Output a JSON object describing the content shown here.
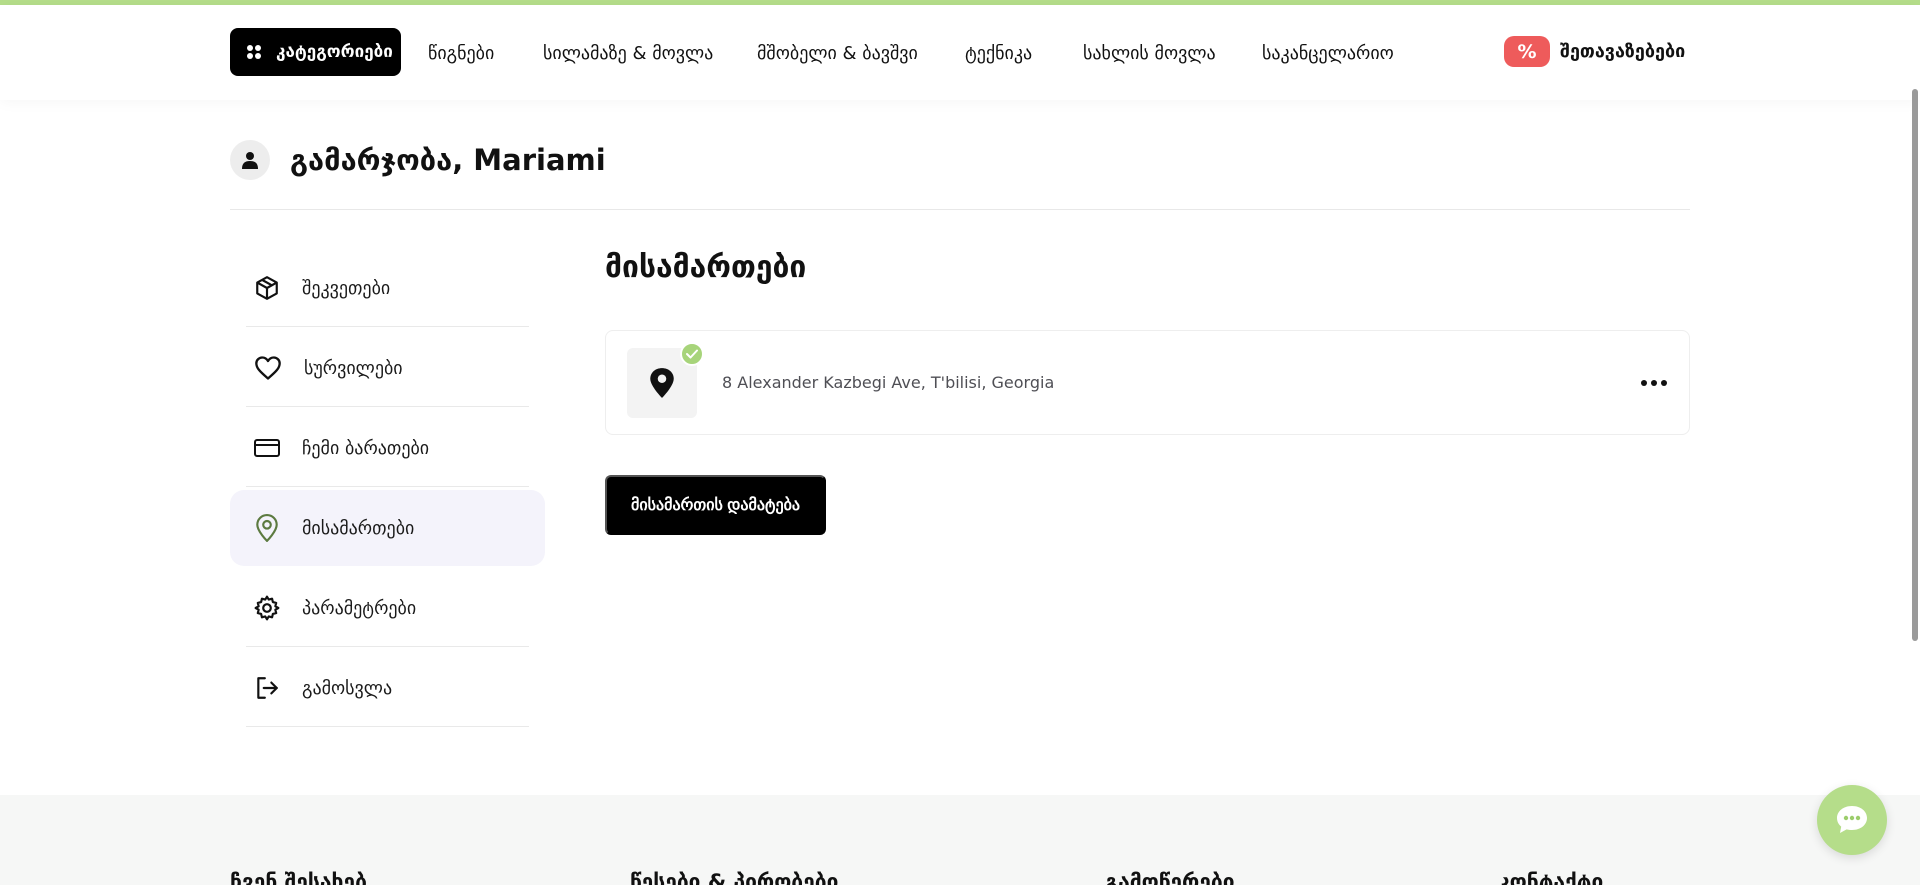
{
  "theme": {
    "accent_green": "#b5dd8a",
    "promo_red": "#ee5b5b",
    "active_bg": "#f4f3fb",
    "check_green": "#a7d47a"
  },
  "topnav": {
    "categories_label": "კატეგორიები",
    "categories_icon": "grid-dots-icon",
    "items": [
      "წიგნები",
      "სილამაზე & მოვლა",
      "მშობელი & ბავშვი",
      "ტექნიკა",
      "სახლის მოვლა",
      "საკანცელარიო"
    ],
    "promo_badge": "%",
    "promo_label": "შეთავაზებები"
  },
  "greeting": {
    "text": "გამარჯობა, Mariami",
    "icon": "user-icon"
  },
  "sidebar": {
    "items": [
      {
        "label": "შეკვეთები",
        "icon": "box-icon"
      },
      {
        "label": "სურვილები",
        "icon": "heart-icon"
      },
      {
        "label": "ჩემი ბარათები",
        "icon": "credit-card-icon"
      },
      {
        "label": "მისამართები",
        "icon": "map-pin-icon",
        "active": true
      },
      {
        "label": "პარამეტრები",
        "icon": "gear-icon"
      },
      {
        "label": "გამოსვლა",
        "icon": "logout-icon"
      }
    ]
  },
  "main": {
    "title": "მისამართები",
    "address": {
      "text": "8 Alexander Kazbegi Ave, T'bilisi, Georgia",
      "icon": "location-pin-icon",
      "default": true
    },
    "add_button_label": "მისამართის დამატება"
  },
  "footer": {
    "columns": [
      "ჩვენ შესახებ",
      "წესები & პირობები",
      "გამოწერები",
      "კონტაქტი"
    ]
  },
  "chat": {
    "icon": "chat-bubble-icon"
  }
}
